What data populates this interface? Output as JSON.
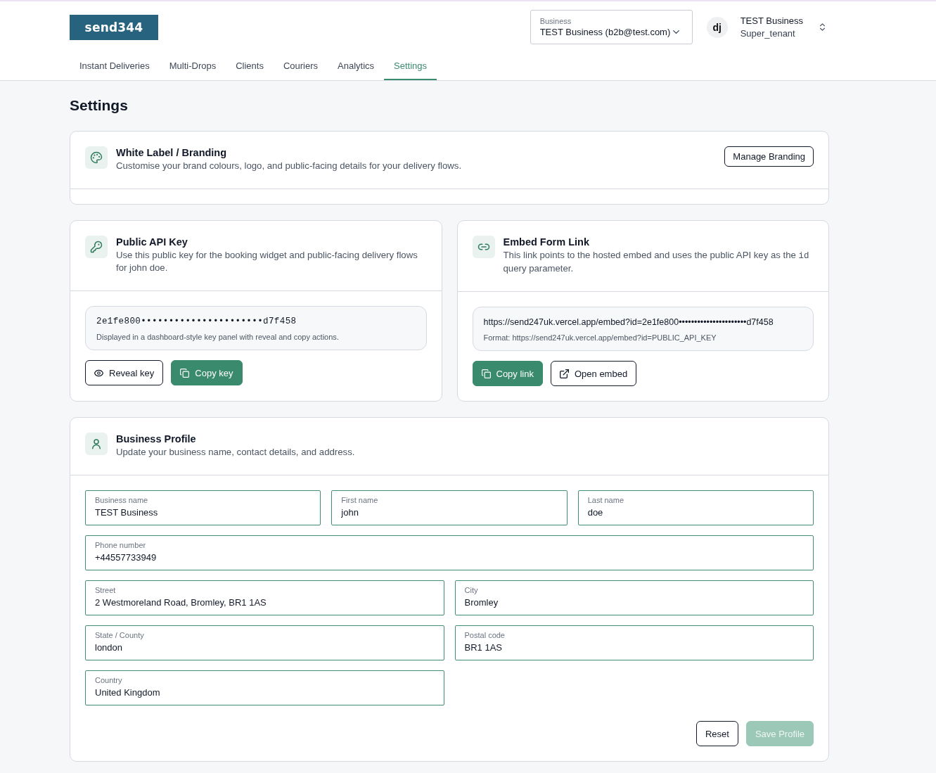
{
  "topbar": {
    "logo": "send344",
    "business_select": {
      "label": "Business",
      "value": "TEST Business (b2b@test.com)"
    },
    "account": {
      "initials": "dj",
      "name": "TEST Business",
      "role": "Super_tenant"
    }
  },
  "tabs": [
    {
      "label": "Instant Deliveries",
      "selected": false
    },
    {
      "label": "Multi-Drops",
      "selected": false
    },
    {
      "label": "Clients",
      "selected": false
    },
    {
      "label": "Couriers",
      "selected": false
    },
    {
      "label": "Analytics",
      "selected": false
    },
    {
      "label": "Settings",
      "selected": true
    }
  ],
  "page_title": "Settings",
  "branding_card": {
    "title": "White Label / Branding",
    "description": "Customise your brand colours, logo, and public-facing details for your delivery flows.",
    "button": "Manage Branding"
  },
  "api_key_card": {
    "title": "Public API Key",
    "description": "Use this public key for the booking widget and public-facing delivery flows for john doe.",
    "key": "2e1fe800••••••••••••••••••••••d7f458",
    "caption": "Displayed in a dashboard-style key panel with reveal and copy actions.",
    "buttons": [
      {
        "label": "Reveal key",
        "kind": "outline"
      },
      {
        "label": "Copy key",
        "kind": "primary"
      }
    ]
  },
  "embed_card": {
    "title": "Embed Form Link",
    "description": {
      "before": "This link points to the hosted embed and uses the public API key as the",
      "code": "id",
      "after": "query parameter."
    },
    "link": "https://send247uk.vercel.app/embed?id=2e1fe800••••••••••••••••••••••d7f458",
    "caption": "Format: https://send247uk.vercel.app/embed?id=PUBLIC_API_KEY",
    "buttons": [
      {
        "label": "Copy link",
        "kind": "primary"
      },
      {
        "label": "Open embed",
        "kind": "outline"
      }
    ]
  },
  "profile_card": {
    "title": "Business Profile",
    "description": "Update your business name, contact details, and address.",
    "name_fields": [
      {
        "label": "Business name",
        "value": "TEST Business"
      },
      {
        "label": "First name",
        "value": "john"
      },
      {
        "label": "Last name",
        "value": "doe"
      }
    ],
    "phone_field": {
      "label": "Phone number",
      "value": "+44557733949"
    },
    "address_fields": [
      {
        "label": "Street",
        "value": "2 Westmoreland Road, Bromley, BR1 1AS"
      },
      {
        "label": "City",
        "value": "Bromley"
      },
      {
        "label": "State / County",
        "value": "london"
      },
      {
        "label": "Postal code",
        "value": "BR1 1AS"
      },
      {
        "label": "Country",
        "value": "United Kingdom"
      }
    ],
    "buttons": [
      {
        "label": "Reset",
        "kind": "outline",
        "disabled": false
      },
      {
        "label": "Save Profile",
        "kind": "primary",
        "disabled": true
      }
    ]
  }
}
